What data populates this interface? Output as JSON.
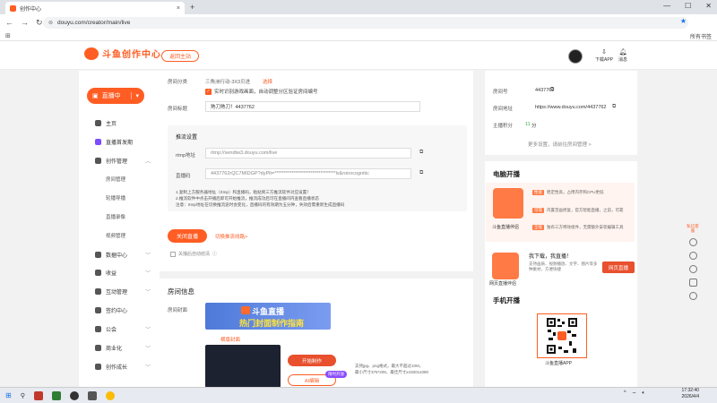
{
  "browser": {
    "tab_title": "创作中心",
    "url": "douyu.com/creator/main/live",
    "all_bookmarks": "所有书签"
  },
  "header": {
    "logo_text": "斗鱼创作中心",
    "back_button": "返回主站",
    "download_app": "下载APP",
    "messages": "消息"
  },
  "sidebar": {
    "live_button": "直播中",
    "items": [
      {
        "label": "主页",
        "icon": "home-icon"
      },
      {
        "label": "直播首发期",
        "icon": "badge-icon"
      },
      {
        "label": "创作管理",
        "icon": "pin-icon",
        "chevron": "up"
      },
      {
        "label": "数据中心",
        "icon": "database-icon",
        "chevron": "down"
      },
      {
        "label": "收益",
        "icon": "coin-icon",
        "chevron": "down"
      },
      {
        "label": "互动管理",
        "icon": "chat-icon",
        "chevron": "down"
      },
      {
        "label": "签约中心",
        "icon": "contract-icon"
      },
      {
        "label": "公会",
        "icon": "guild-icon",
        "chevron": "down"
      },
      {
        "label": "商业化",
        "icon": "shop-icon",
        "chevron": "down"
      },
      {
        "label": "创作成长",
        "icon": "growth-icon",
        "chevron": "down"
      }
    ],
    "sub_items": [
      "房间管理",
      "轮播导播",
      "直播录像",
      "视频管理"
    ]
  },
  "main": {
    "room_category_label": "房间分类",
    "room_category_value": "三角洲行动-3X3贝进",
    "select_link": "选择",
    "game_checkbox": "实时识别游戏画面，自动调整分区验证房间编号",
    "room_title_label": "房间标题",
    "room_title_value": "熟刀熟刀！4437762",
    "stream_settings_title": "推流设置",
    "rtmp_label": "rtmp地址",
    "rtmp_value": "rtmp://sendtw3.douyu.com/live",
    "stream_key_label": "直播码",
    "stream_key_value": "4437762rQC7MIDGP?dyPlt=********************************lv&roirocognitic",
    "notes": [
      "1.复制上方服务器地址（rtmp）和直播码，粘贴到三方推流软件对应设置！",
      "2.推流软件中点击开播后即可开始推流，推流成功后可在直播间内查看直播状态",
      "注意：rtmp地址在切换推流途时会变化，直播码的有效期为五分钟，失效后需重新生成直播码"
    ],
    "close_live": "关闭直播",
    "switch_line": "切换推流线路>",
    "auto_close": "关播后自动结清",
    "room_info_title": "房间信息",
    "room_cover_label": "房间封面",
    "banner_line1": "斗鱼直播",
    "banner_line2": "热门封面制作指南",
    "template_label": "横版封面",
    "make_button": "开始制作",
    "ai_button": "AI编辑",
    "ai_badge": "限时开放",
    "cover_hint_1": "支持jpg、png格式，最大不超过10M，",
    "cover_hint_2": "最小尺寸375*209，最佳尺寸≥1920x1080"
  },
  "right_panel": {
    "room_id_label": "房间号",
    "room_id_value": "4437762",
    "room_url_label": "房间地址",
    "room_url_value": "https://www.douyu.com/4437762",
    "score_label": "主播积分",
    "score_value": "11",
    "score_unit": "分",
    "more_settings": "更多设置，请前往房间管理 >",
    "pc_title": "电脑开播",
    "pc_card_label": "斗鱼直播伴侣",
    "pc_lines": [
      {
        "tag": "性能",
        "text": "稳定性高，占用内存和CPU更低"
      },
      {
        "tag": "可靠",
        "text": "内置音画修复，官方智能直播，之前，可靠"
      },
      {
        "tag": "全能",
        "text": "独有三方特效组件，无需额外安装编辑工具"
      }
    ],
    "web_label": "网页直播伴侣",
    "web_title": "我下载，我直播！",
    "web_desc": "支持画质、视频播放、文字、图片等多种素材，方便快捷",
    "web_button": "网页直播",
    "mobile_title": "手机开播",
    "qr_label": "斗鱼直播APP"
  },
  "floatbar": {
    "top_label": "私信客服"
  },
  "taskbar": {
    "time": "17:32:40",
    "date": "2026/4/4"
  },
  "colors": {
    "accent": "#ff5d23",
    "background": "#f2f2f2"
  }
}
